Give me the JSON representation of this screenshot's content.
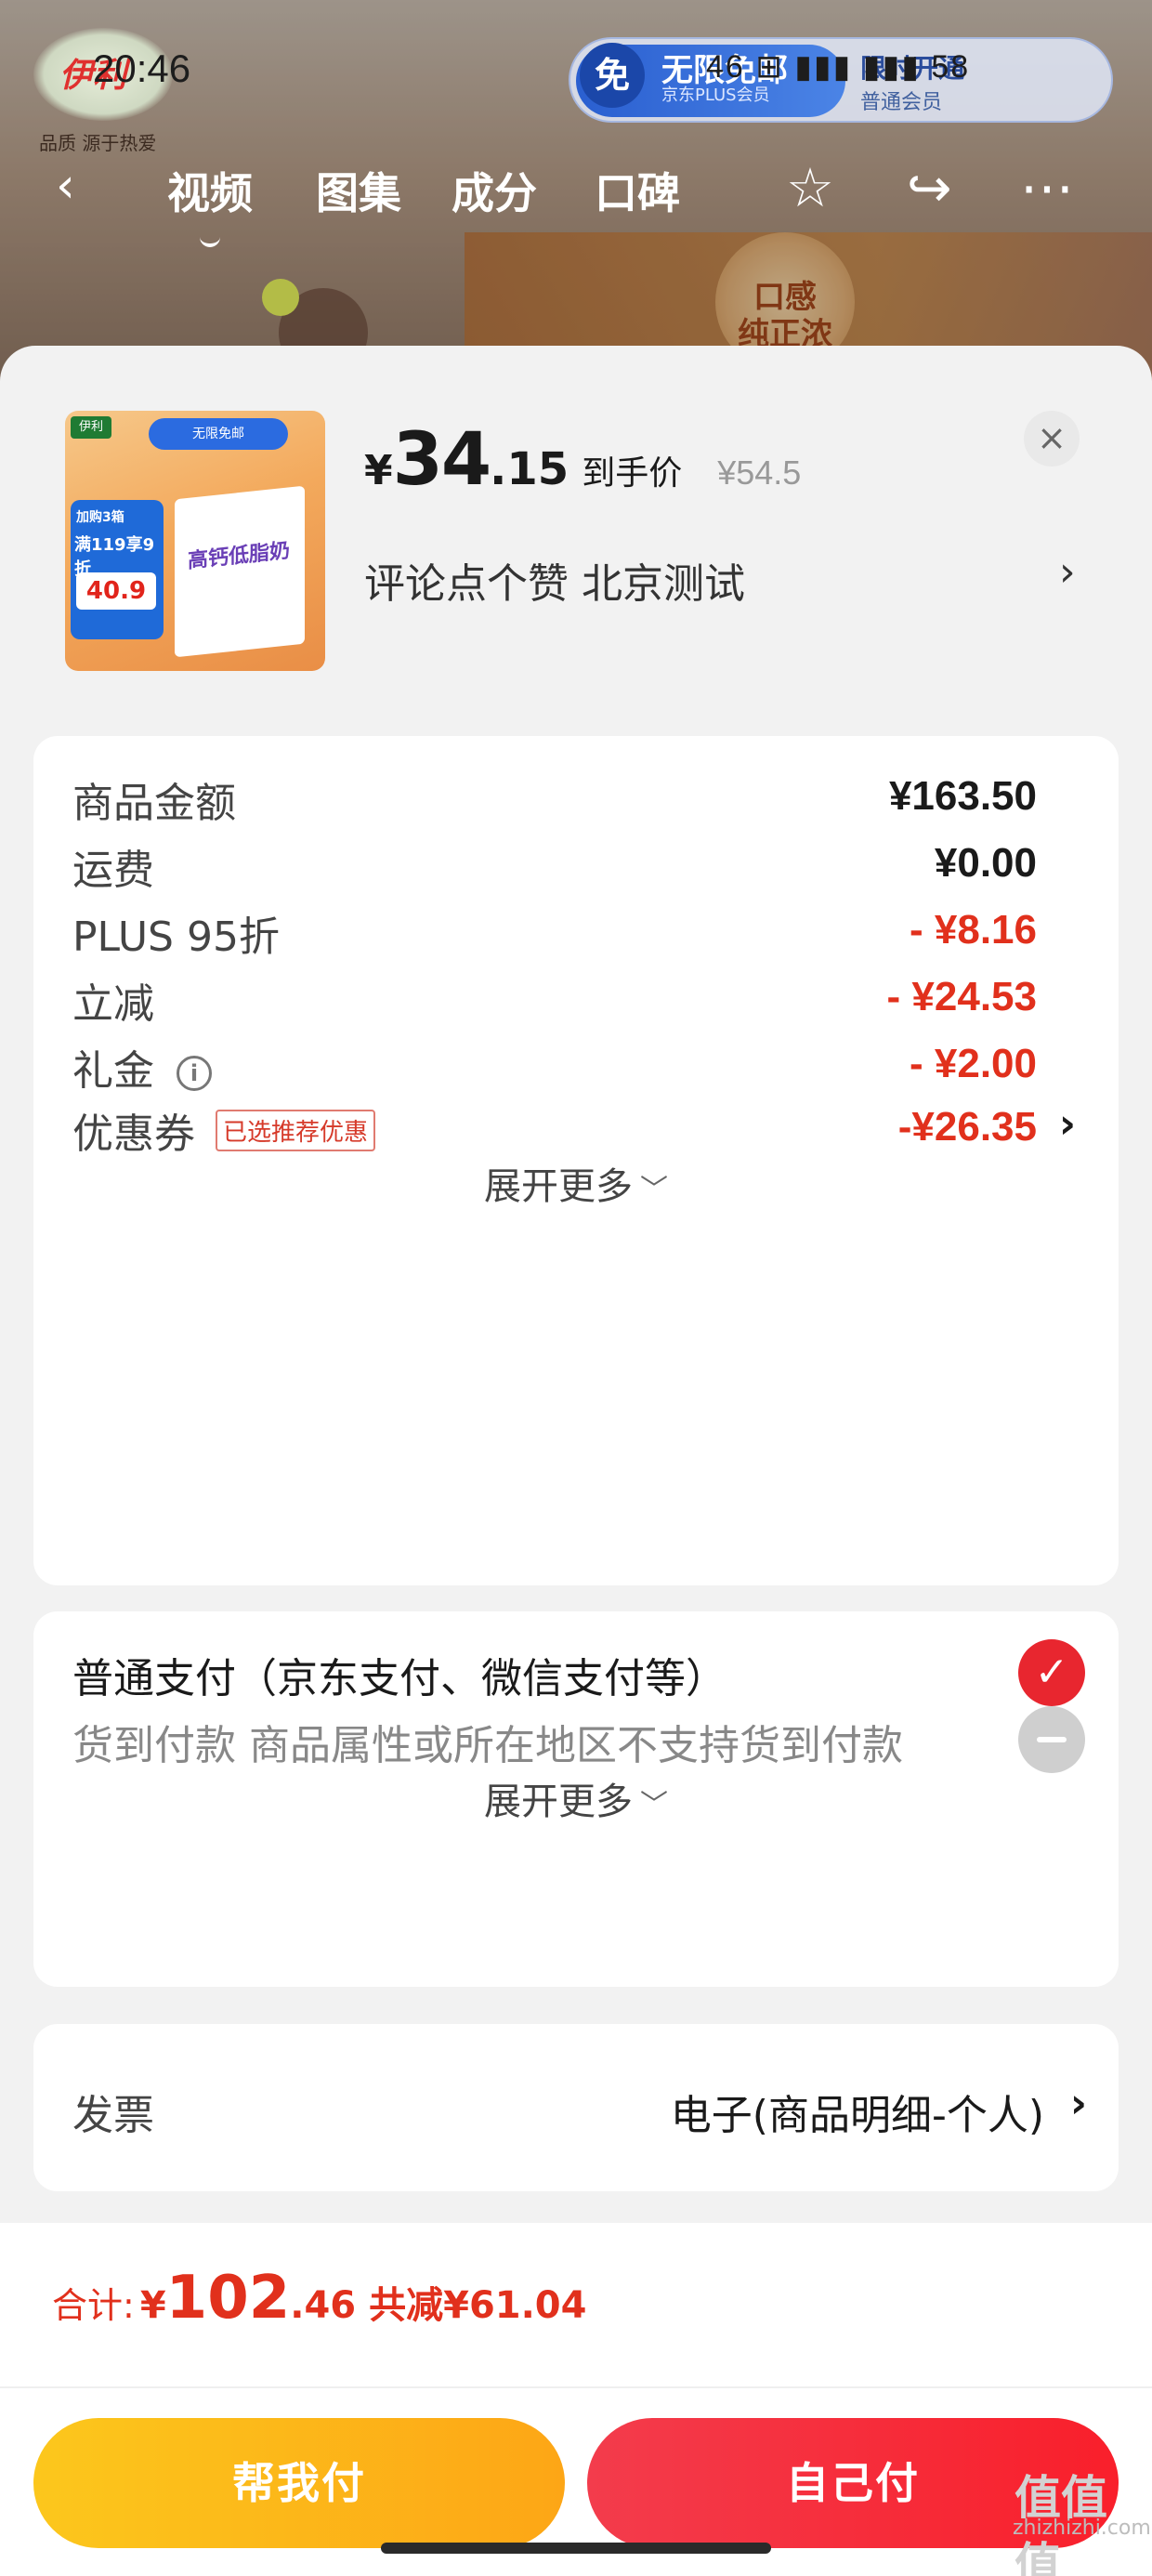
{
  "status_bar": {
    "time": "20:46",
    "icons_text": "46 ⊞ ▮▮▮ ▮▮▮ 58"
  },
  "background": {
    "brand_logo": "伊利",
    "brand_slogan": "品质 源于热爱",
    "plus_badge": {
      "free_glyph": "免",
      "title": "无限免邮",
      "subtitle": "京东PLUS会员",
      "right_title": "限时开通",
      "right_sub": "普通会员"
    },
    "nav_tabs": [
      "视频",
      "图集",
      "成分",
      "口碑"
    ],
    "active_tab": "视频",
    "slogan": "口感 纯正浓香"
  },
  "product": {
    "thumb": {
      "logo": "伊利",
      "chip": "无限免邮",
      "promo_a": "加购3箱",
      "promo_b": "满119享9折",
      "promo_c": "40.9",
      "box_text": "高钙低脂奶"
    },
    "price_currency": "¥",
    "price_int": "34",
    "price_dec": ".15",
    "price_tag": "到手价",
    "original_price": "¥54.5",
    "subtitle": "评论点个赞  北京测试",
    "close_label": "×",
    "chevron": "›"
  },
  "amount_breakdown": {
    "rows": [
      {
        "label": "商品金额",
        "value": "¥163.50"
      },
      {
        "label": "运费",
        "value": "¥0.00"
      },
      {
        "label": "PLUS 95折",
        "value": "- ¥8.16"
      },
      {
        "label": "立减",
        "value": "- ¥24.53"
      },
      {
        "label": "礼金",
        "value": "- ¥2.00",
        "info_icon": "i"
      },
      {
        "label": "优惠券",
        "value": "-¥26.35",
        "chip": "已选推荐优惠"
      }
    ],
    "expand_label": "展开更多",
    "caret": "﹀"
  },
  "payment": {
    "options": [
      {
        "label": "普通支付（京东支付、微信支付等）",
        "selected": true
      },
      {
        "label": "货到付款 商品属性或所在地区不支持货到付款",
        "selected": false
      }
    ],
    "check_glyph": "✓",
    "expand_label": "展开更多"
  },
  "invoice": {
    "label": "发票",
    "value": "电子(商品明细-个人)"
  },
  "footer": {
    "total_label": "合计:",
    "total_currency": "¥",
    "total_int": "102",
    "total_dec": ".46",
    "saved_text": "共减¥61.04",
    "help_pay_label": "帮我付",
    "self_pay_label": "自己付"
  },
  "watermark": {
    "text": "zhizhizhi.com",
    "sign": "值值值"
  },
  "colors": {
    "accent_red": "#e1301c",
    "yellow_button": "#fdb618",
    "red_button": "#f52a38"
  }
}
